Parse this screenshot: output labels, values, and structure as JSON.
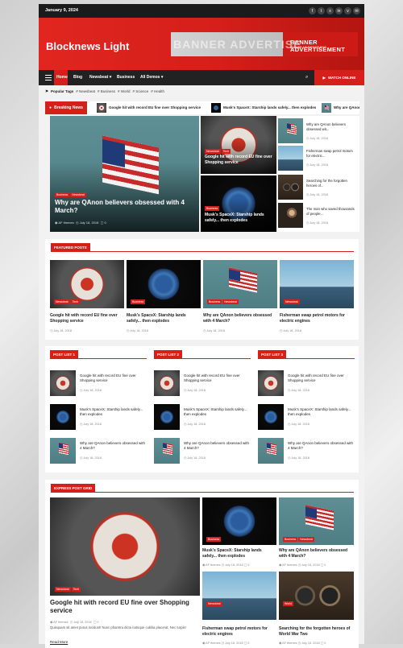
{
  "topbar": {
    "date": "January 9, 2024",
    "social": [
      "f",
      "t",
      "x",
      "in",
      "v",
      "✉"
    ]
  },
  "header": {
    "site_title": "Blocknews Light",
    "banner_ghost": "BANNER ADVERTISE",
    "banner_text": "BANNER ADVERTISEMENT",
    "banner_sub": "BANNER ADVERTISEMENT"
  },
  "nav": {
    "items": [
      "Home",
      "Blog",
      "Newsbeat ▾",
      "Business",
      "All Demos ▾"
    ],
    "watch": "WATCH ONLINE"
  },
  "tags": {
    "label": "Popular Tags",
    "items": [
      "Newsbeat",
      "Business",
      "World",
      "Science",
      "Health"
    ]
  },
  "breaking": {
    "label": "Breaking News",
    "items": [
      "Google hit with record EU fine over Shopping service",
      "Musk's SpaceX: Starship lands safely... then explodes",
      "Why are QAnon beli"
    ]
  },
  "hero": {
    "main": {
      "badges": [
        "Business",
        "Newsbeat"
      ],
      "title": "Why are QAnon believers obsessed with 4 March?",
      "author": "AF themes",
      "date": "July 18, 2018",
      "comments": "0"
    },
    "mid": [
      {
        "badges": [
          "Newsbeat",
          "Tech"
        ],
        "title": "Google hit with record EU fine over Shopping service"
      },
      {
        "badges": [
          "Business"
        ],
        "title": "Musk's SpaceX: Starship lands safely... then explodes"
      }
    ],
    "side": [
      {
        "title": "Why are QAnon believers obsessed wit...",
        "date": "July 18, 2018"
      },
      {
        "title": "Fisherman swap petrol motors for electric...",
        "date": "July 18, 2018"
      },
      {
        "title": "Searching for the forgotten heroes of...",
        "date": "July 18, 2018"
      },
      {
        "title": "The man who saved thousands of people...",
        "date": "July 18, 2018"
      }
    ]
  },
  "featured": {
    "label": "FEATURED POSTS",
    "items": [
      {
        "badges": [
          "Newsbeat",
          "Tech"
        ],
        "title": "Google hit with record EU fine over Shopping service",
        "date": "July 18, 2018"
      },
      {
        "badges": [
          "Business"
        ],
        "title": "Musk's SpaceX: Starship lands safely... then explodes",
        "date": "July 18, 2018"
      },
      {
        "badges": [
          "Business",
          "Newsbeat"
        ],
        "title": "Why are QAnon believers obsessed with 4 March?",
        "date": "July 18, 2018"
      },
      {
        "badges": [
          "Newsbeat"
        ],
        "title": "Fisherman swap petrol motors for electric engines",
        "date": "July 18, 2018"
      }
    ]
  },
  "lists": [
    {
      "label": "POST LIST 1"
    },
    {
      "label": "POST LIST 2"
    },
    {
      "label": "POST LIST 3"
    }
  ],
  "list_items": [
    {
      "title": "Google hit with record EU fine over Shopping service",
      "date": "July 18, 2018"
    },
    {
      "title": "Musk's SpaceX: Starship lands safely... then explodes",
      "date": "July 18, 2018"
    },
    {
      "title": "Why are QAnon believers obsessed with 4 March?",
      "date": "July 18, 2018"
    }
  ],
  "express": {
    "label": "EXPRESS POST GRID",
    "main": {
      "badges": [
        "Newsbeat",
        "Tech"
      ],
      "title": "Google hit with record EU fine over Shopping service",
      "author": "AF themes",
      "date": "July 18, 2018",
      "comments": "0",
      "excerpt": "Quisquam sit amet purus incidunt! Nunc pharetra dicta natoque cubilia placerat. Nec turpis!",
      "read_more": "Read More"
    },
    "grid": [
      {
        "badges": [
          "Business"
        ],
        "title": "Musk's SpaceX: Starship lands safely... then explodes",
        "author": "AF themes",
        "date": "July 18, 2018",
        "comments": "0"
      },
      {
        "badges": [
          "Business",
          "Newsbeat"
        ],
        "title": "Why are QAnon believers obsessed with 4 March?",
        "author": "AF themes",
        "date": "July 18, 2018",
        "comments": "0"
      },
      {
        "badges": [
          "Newsbeat"
        ],
        "title": "Fisherman swap petrol motors for electric engines",
        "author": "AF themes",
        "date": "July 18, 2018",
        "comments": "0"
      },
      {
        "badges": [
          "World"
        ],
        "title": "Searching for the forgotten heroes of World War Two",
        "author": "AF themes",
        "date": "July 18, 2018",
        "comments": "0"
      }
    ]
  }
}
